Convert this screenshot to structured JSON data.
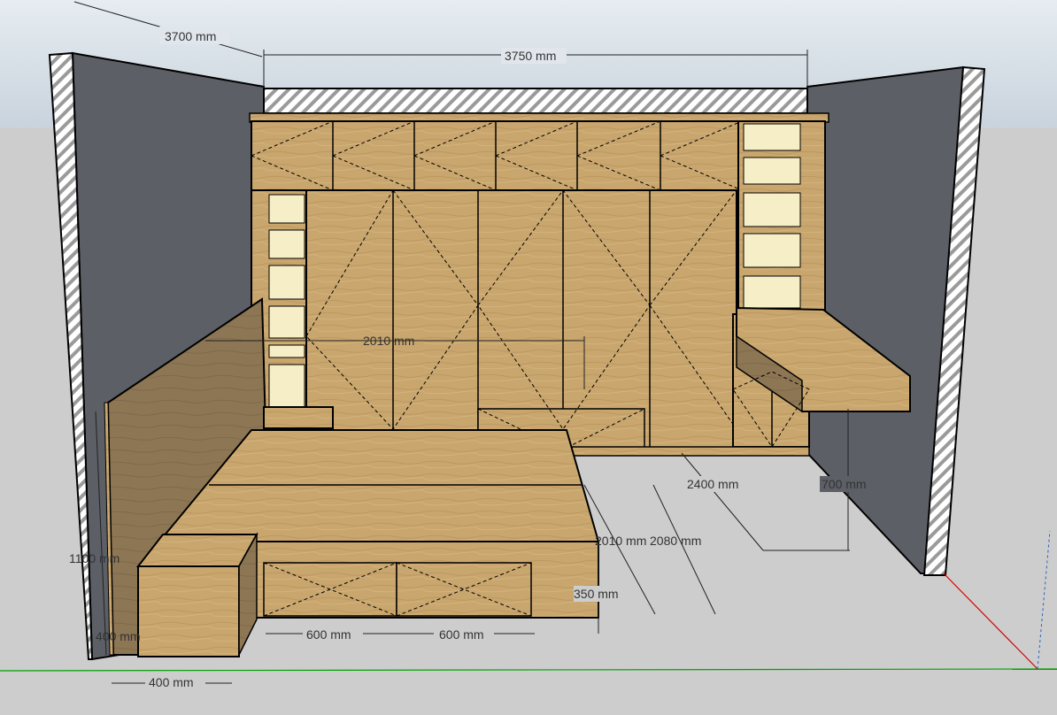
{
  "colors": {
    "sky": "#d3dce6",
    "ground": "#cdcdcd",
    "wall": "#5c5f65",
    "wood": "#c9a66e",
    "wood_dark": "#8a7352",
    "cell": "#f6eec6",
    "axis_red": "#d40000",
    "axis_green": "#00a000"
  },
  "dimensions": {
    "room_depth": "3700 mm",
    "wall_width": "3750 mm",
    "wardrobe_height": "2010 mm",
    "bed_length_a": "2400 mm",
    "desk_height": "700 mm",
    "bed_width_a": "2010 mm",
    "bed_width_b": "2080 mm",
    "headboard_height": "1100 mm",
    "bed_base_height": "350 mm",
    "drawer_1": "600 mm",
    "drawer_2": "600 mm",
    "nightstand_width": "400 mm",
    "nightstand_height": "400 mm"
  }
}
